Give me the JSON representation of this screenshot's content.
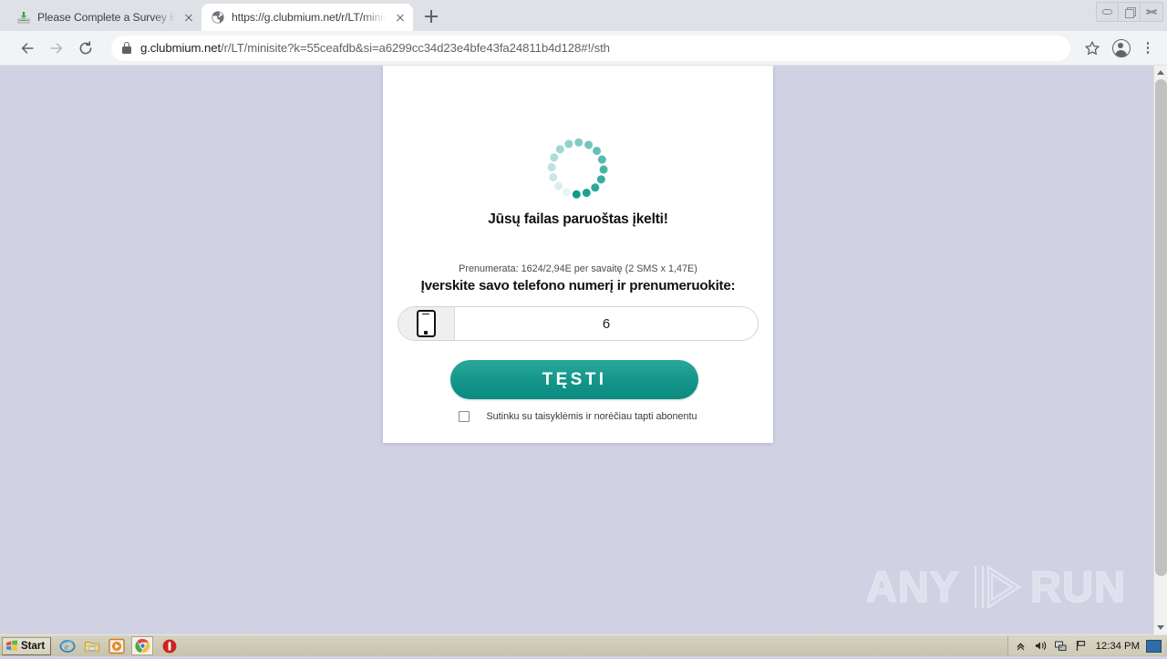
{
  "browser": {
    "tabs": [
      {
        "title": "Please Complete a Survey Below to c",
        "favicon": "download-icon",
        "active": false
      },
      {
        "title": "https://g.clubmium.net/r/LT/minisite",
        "favicon": "globe-icon",
        "active": true
      }
    ],
    "new_tab_label": "+",
    "window_controls": {
      "minimize": "minimize-icon",
      "maximize": "restore-icon",
      "close": "close-icon"
    },
    "toolbar": {
      "back": "←",
      "forward": "→",
      "reload": "⟳",
      "lock_icon": "lock-icon",
      "url_host": "g.clubmium.net",
      "url_path": "/r/LT/minisite?k=55ceafdb&si=a6299cc34d23e4bfe43fa24811b4d128#!/sth",
      "star": "☆",
      "profile": "profile-icon",
      "menu": "kebab-menu-icon"
    }
  },
  "page": {
    "spinner": {
      "name": "loading-spinner",
      "dot_count": 16,
      "color": "#0f9b8e"
    },
    "headline": "Jūsų failas paruoštas įkelti!",
    "subscription_note": "Prenumerata: 1624/2,94E per savaitę (2 SMS x 1,47E)",
    "prompt_label": "Įverskite savo telefono numerį ir prenumeruokite:",
    "phone_input": {
      "icon": "smartphone-icon",
      "value": "6",
      "placeholder": ""
    },
    "continue_button": {
      "label": "TĘSTI",
      "color": "#15978b"
    },
    "terms": {
      "checked": false,
      "label": "Sutinku su taisyklėmis ir norėčiau tapti abonentu"
    },
    "background_color": "#d0d2e4",
    "card_color": "#ffffff"
  },
  "watermark": {
    "left_text": "ANY",
    "right_text": "RUN",
    "logo": "play-triangle-logo"
  },
  "scrollbar": {
    "up_arrow": "chevron-up-icon",
    "down_arrow": "chevron-down-icon",
    "thumb": "scroll-thumb"
  },
  "taskbar": {
    "start_label": "Start",
    "quick_launch": [
      {
        "name": "internet-explorer-icon"
      },
      {
        "name": "folder-icon"
      },
      {
        "name": "media-player-icon"
      },
      {
        "name": "chrome-icon"
      },
      {
        "name": "stop-record-icon"
      }
    ],
    "tray": [
      {
        "name": "show-hidden-icons-icon"
      },
      {
        "name": "volume-icon"
      },
      {
        "name": "network-icon"
      },
      {
        "name": "flag-icon"
      }
    ],
    "clock": "12:34 PM"
  }
}
